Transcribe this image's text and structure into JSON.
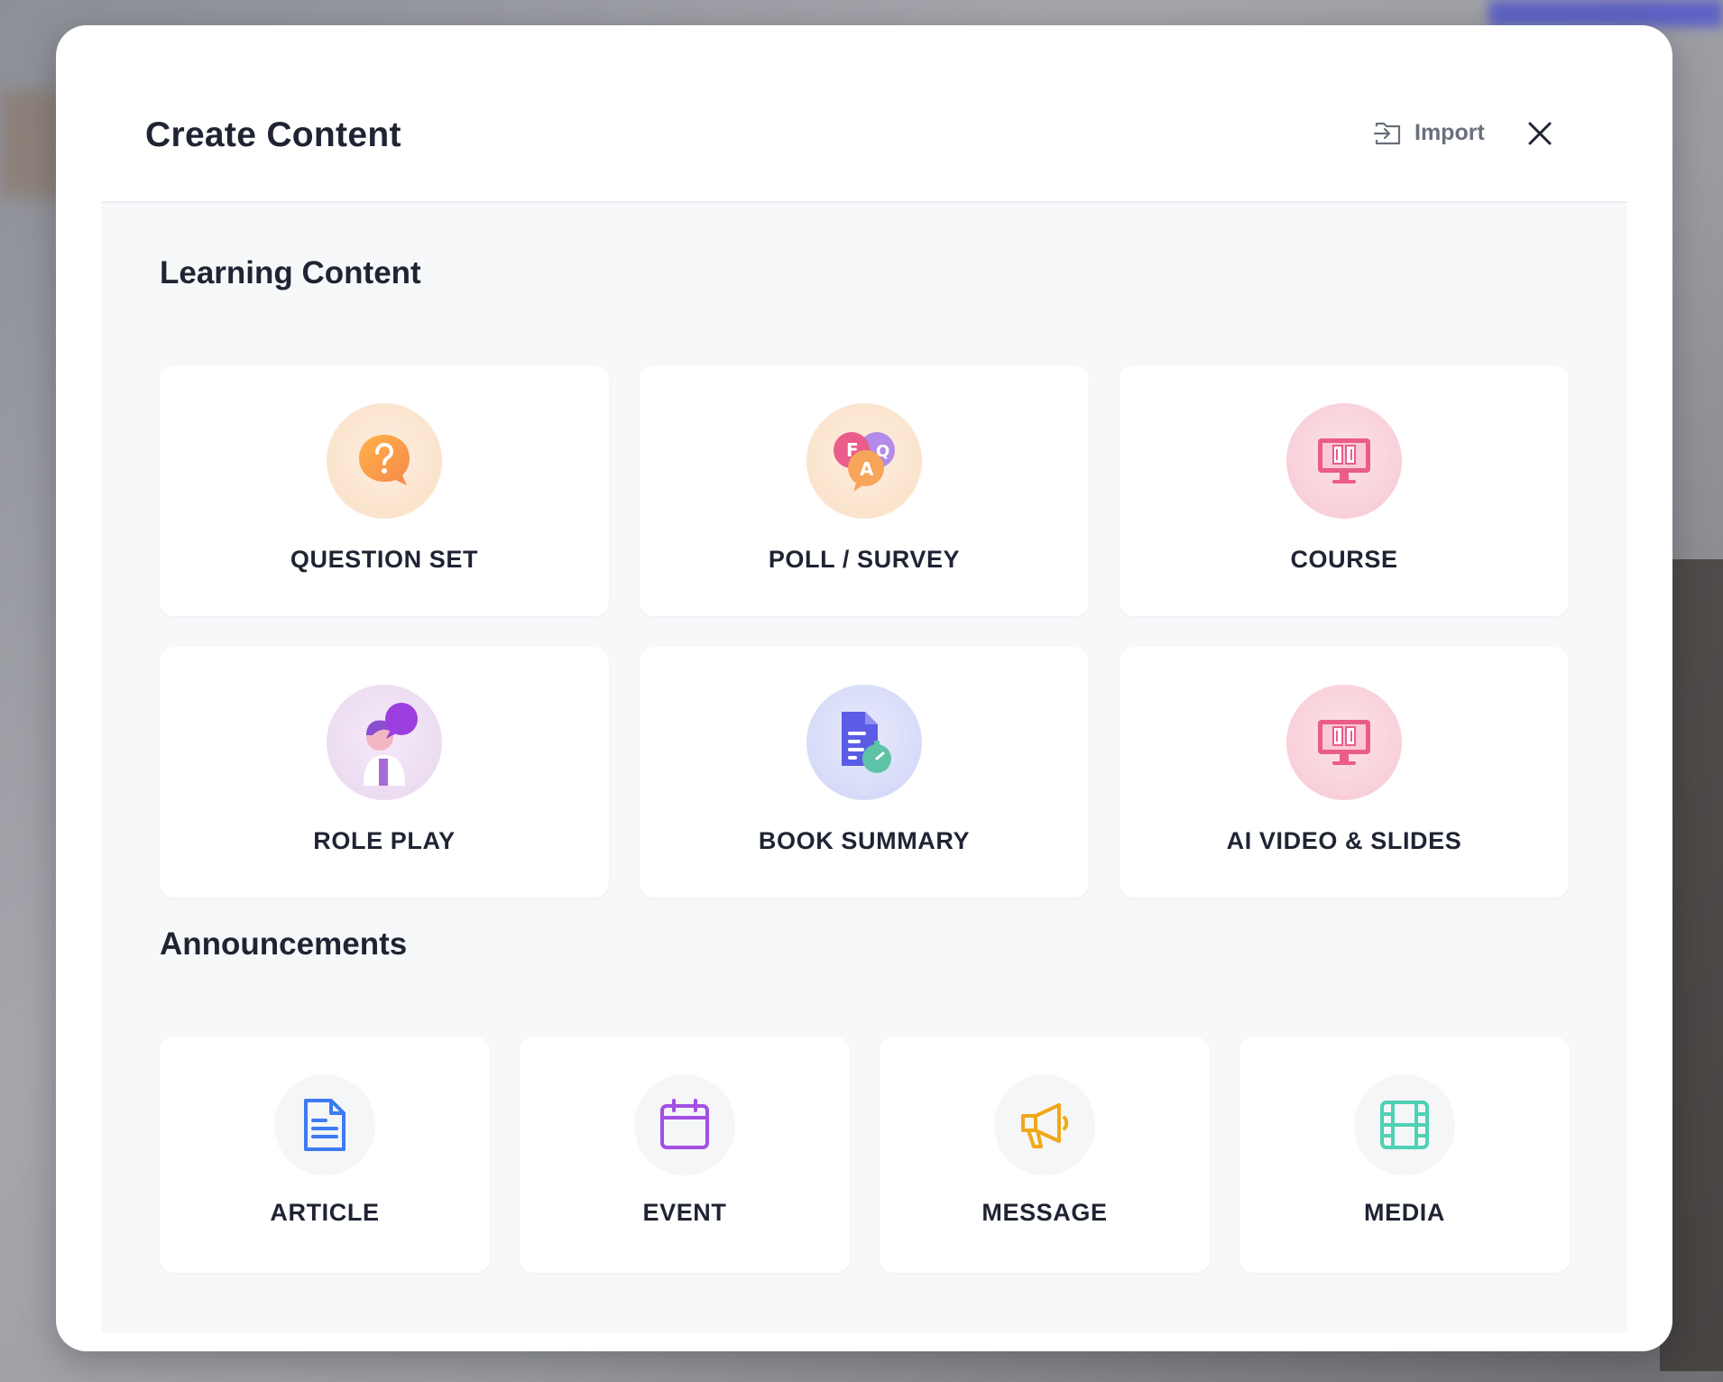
{
  "dialog": {
    "title": "Create Content",
    "import_label": "Import",
    "close_label": "Close"
  },
  "learning": {
    "heading": "Learning Content",
    "items": [
      {
        "label": "QUESTION SET",
        "icon": "question-bubble-icon"
      },
      {
        "label": "POLL / SURVEY",
        "icon": "faq-bubbles-icon"
      },
      {
        "label": "COURSE",
        "icon": "monitor-book-icon"
      },
      {
        "label": "ROLE PLAY",
        "icon": "person-speech-icon"
      },
      {
        "label": "BOOK SUMMARY",
        "icon": "document-timer-icon"
      },
      {
        "label": "AI VIDEO & SLIDES",
        "icon": "monitor-book-icon"
      }
    ]
  },
  "announcements": {
    "heading": "Announcements",
    "items": [
      {
        "label": "ARTICLE",
        "icon": "document-icon",
        "color": "#3d7bf2"
      },
      {
        "label": "EVENT",
        "icon": "calendar-icon",
        "color": "#a24fe3"
      },
      {
        "label": "MESSAGE",
        "icon": "megaphone-icon",
        "color": "#f0a81a"
      },
      {
        "label": "MEDIA",
        "icon": "film-icon",
        "color": "#4fd1b5"
      }
    ]
  }
}
